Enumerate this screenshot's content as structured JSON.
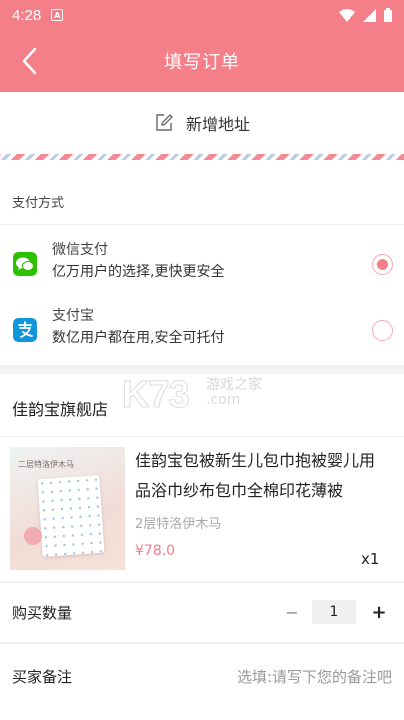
{
  "status_bar": {
    "time": "4:28",
    "notif_icon": "A"
  },
  "nav": {
    "title": "填写订单"
  },
  "address": {
    "add_label": "新增地址"
  },
  "payment": {
    "section_title": "支付方式",
    "options": [
      {
        "name": "微信支付",
        "desc": "亿万用户的选择,更快更安全",
        "icon": "wechat-pay-icon",
        "selected": true
      },
      {
        "name": "支付宝",
        "desc": "数亿用户都在用,安全可托付",
        "icon": "alipay-icon",
        "selected": false
      }
    ]
  },
  "shop": {
    "name": "佳韵宝旗舰店",
    "product": {
      "image_label": "二层特洛伊木马",
      "title": "佳韵宝包被新生儿包巾抱被婴儿用品浴巾纱布包巾全棉印花薄被",
      "spec": "2层特洛伊木马",
      "price": "¥78.0",
      "qty": "x1"
    }
  },
  "quantity": {
    "label": "购买数量",
    "minus": "−",
    "value": "1",
    "plus": "+"
  },
  "remark": {
    "label": "买家备注",
    "placeholder": "选填:请写下您的备注吧"
  },
  "watermark": {
    "brand": "K73",
    "cn": "游戏之家",
    "domain": ".com"
  },
  "colors": {
    "primary": "#f47f88",
    "price": "#f27e8a",
    "wechat": "#2dc100",
    "alipay": "#1296db"
  }
}
